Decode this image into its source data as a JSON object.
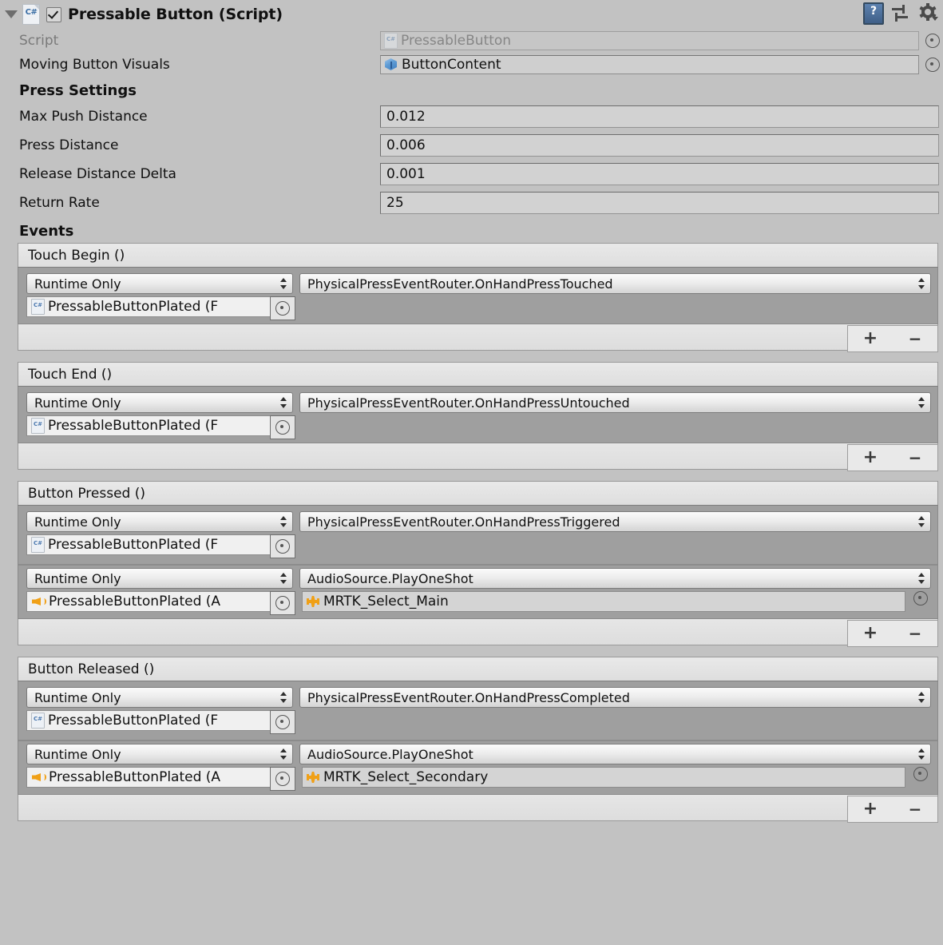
{
  "header": {
    "title": "Pressable Button (Script)",
    "enabled": true,
    "script_icon": "csharp-script-icon",
    "help_icon": "help-book-icon",
    "preset_icon": "preset-icon",
    "settings_icon": "gear-icon"
  },
  "properties": [
    {
      "label": "Script",
      "value": "PressableButton",
      "icon": "csharp-script-icon",
      "disabled": true
    },
    {
      "label": "Moving Button Visuals",
      "value": "ButtonContent",
      "icon": "prefab-cube-icon",
      "disabled": false
    }
  ],
  "press_settings": {
    "title": "Press Settings",
    "fields": [
      {
        "label": "Max Push Distance",
        "value": "0.012"
      },
      {
        "label": "Press Distance",
        "value": "0.006"
      },
      {
        "label": "Release Distance Delta",
        "value": "0.001"
      },
      {
        "label": "Return Rate",
        "value": "25"
      }
    ]
  },
  "events": {
    "title": "Events",
    "add_label": "+",
    "remove_label": "−",
    "blocks": [
      {
        "title": "Touch Begin ()",
        "entries": [
          {
            "mode": "Runtime Only",
            "function": "PhysicalPressEventRouter.OnHandPressTouched",
            "target": "PressableButtonPlated (F",
            "target_icon": "csharp-script-icon",
            "argument": null,
            "argument_icon": null
          }
        ]
      },
      {
        "title": "Touch End ()",
        "entries": [
          {
            "mode": "Runtime Only",
            "function": "PhysicalPressEventRouter.OnHandPressUntouched",
            "target": "PressableButtonPlated (F",
            "target_icon": "csharp-script-icon",
            "argument": null,
            "argument_icon": null
          }
        ]
      },
      {
        "title": "Button Pressed ()",
        "entries": [
          {
            "mode": "Runtime Only",
            "function": "PhysicalPressEventRouter.OnHandPressTriggered",
            "target": "PressableButtonPlated (F",
            "target_icon": "csharp-script-icon",
            "argument": null,
            "argument_icon": null
          },
          {
            "mode": "Runtime Only",
            "function": "AudioSource.PlayOneShot",
            "target": "PressableButtonPlated (A",
            "target_icon": "audio-source-icon",
            "argument": "MRTK_Select_Main",
            "argument_icon": "audio-clip-icon"
          }
        ]
      },
      {
        "title": "Button Released ()",
        "entries": [
          {
            "mode": "Runtime Only",
            "function": "PhysicalPressEventRouter.OnHandPressCompleted",
            "target": "PressableButtonPlated (F",
            "target_icon": "csharp-script-icon",
            "argument": null,
            "argument_icon": null
          },
          {
            "mode": "Runtime Only",
            "function": "AudioSource.PlayOneShot",
            "target": "PressableButtonPlated (A",
            "target_icon": "audio-source-icon",
            "argument": "MRTK_Select_Secondary",
            "argument_icon": "audio-clip-icon"
          }
        ]
      }
    ]
  },
  "colors": {
    "background": "#c2c2c2",
    "event_body": "#9f9f9f",
    "accent_orange": "#f0a016",
    "accent_blue": "#5e9bd4"
  }
}
